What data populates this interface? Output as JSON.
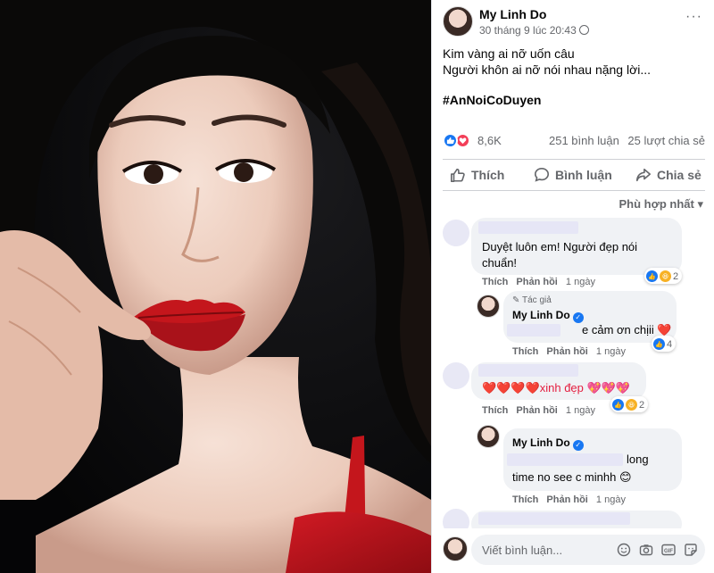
{
  "post": {
    "author": "My Linh Do",
    "timestamp": "30 tháng 9 lúc 20:43",
    "more_label": "···",
    "text_line1": "Kim vàng ai nỡ uốn câu",
    "text_line2": "Người khôn ai nỡ nói nhau nặng lời...",
    "hashtag": "#AnNoiCoDuyen"
  },
  "stats": {
    "reactions": "8,6K",
    "comments": "251 bình luận",
    "shares": "25 lượt chia sẻ"
  },
  "actions": {
    "like": "Thích",
    "comment": "Bình luận",
    "share": "Chia sẻ"
  },
  "sort_label": "Phù hợp nhất",
  "comments": [
    {
      "text_line1": "Duyệt luôn em! Người đẹp nói",
      "text_line2": "chuẩn!",
      "like_label": "Thích",
      "reply_label": "Phản hồi",
      "time": "1 ngày",
      "reaction_count": "2"
    },
    {
      "author_tag": "Tác giả",
      "name": "My Linh Do",
      "text": "e cảm ơn chịii ❤️",
      "like_label": "Thích",
      "reply_label": "Phản hồi",
      "time": "1 ngày",
      "reaction_count": "4"
    },
    {
      "text": "❤️❤️❤️❤️xinh đẹp 💖💖💖",
      "like_label": "Thích",
      "reply_label": "Phản hồi",
      "time": "1 ngày",
      "reaction_count": "2"
    },
    {
      "name": "My Linh Do",
      "text_line1": "long",
      "text_line2": "time no see c minhh 😊",
      "like_label": "Thích",
      "reply_label": "Phản hồi",
      "time": "1 ngày"
    }
  ],
  "comment_input": {
    "placeholder": "Viết bình luận..."
  },
  "colors": {
    "brand_blue": "#1877f2",
    "love_red": "#f33e58",
    "secondary_text": "#65676b",
    "bubble_bg": "#f0f2f5",
    "lip_red": "#c4161c"
  },
  "icons": [
    "more-icon",
    "globe-icon",
    "like-reaction-icon",
    "love-reaction-icon",
    "like-icon",
    "comment-icon",
    "share-icon",
    "verified-icon",
    "pencil-icon",
    "emoji-icon",
    "camera-icon",
    "gif-icon",
    "sticker-icon"
  ]
}
